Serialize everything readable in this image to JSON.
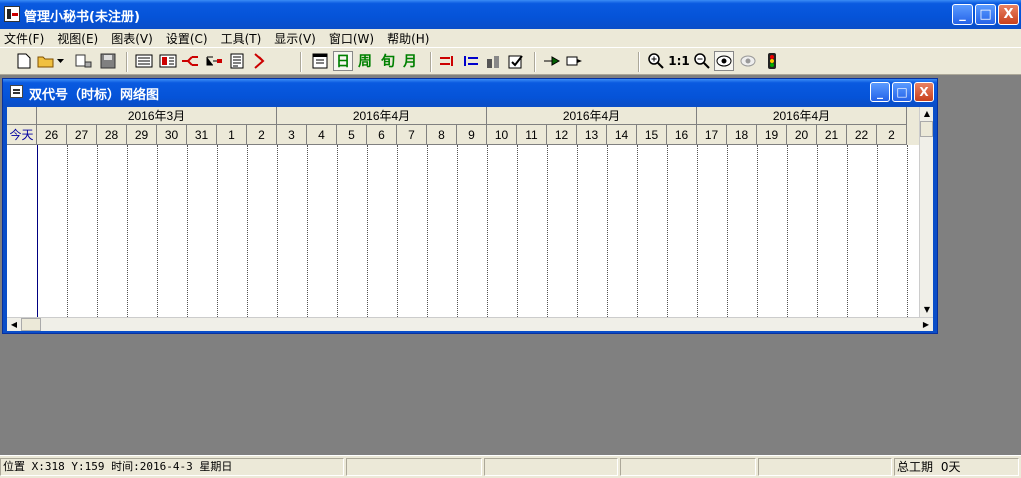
{
  "window": {
    "title": "管理小秘书(未注册)",
    "controls": {
      "minimize": "_",
      "maximize": "□",
      "close": "X"
    }
  },
  "menu": [
    "文件(F)",
    "视图(E)",
    "图表(V)",
    "设置(C)",
    "工具(T)",
    "显示(V)",
    "窗口(W)",
    "帮助(H)"
  ],
  "toolbar": {
    "scale_labels": [
      "日",
      "周",
      "旬",
      "月"
    ],
    "zoom_ratio": "1:1",
    "icons": [
      "new-file-icon",
      "open-folder-icon",
      "dropdown-icon",
      "preview-icon",
      "save-icon",
      "view1-icon",
      "view2-icon",
      "network-icon",
      "tree-icon",
      "report-icon",
      "logic-icon",
      "calendar-icon",
      "link1-icon",
      "link2-icon",
      "resource-icon",
      "check-icon",
      "arrow-icon",
      "zoom-in-icon",
      "zoom-out-icon",
      "eye-icon",
      "eye-gray-icon",
      "traffic-light-icon"
    ]
  },
  "child_window": {
    "title": "双代号（时标）网络图",
    "controls": {
      "minimize": "_",
      "maximize": "□",
      "close": "X"
    }
  },
  "gantt": {
    "months": [
      {
        "label": "2016年3月",
        "days": 8
      },
      {
        "label": "2016年4月",
        "days": 7
      },
      {
        "label": "2016年4月",
        "days": 7
      },
      {
        "label": "2016年4月",
        "days": 7
      }
    ],
    "today_label": "今天",
    "days": [
      "26",
      "27",
      "28",
      "29",
      "30",
      "31",
      "1",
      "2",
      "3",
      "4",
      "5",
      "6",
      "7",
      "8",
      "9",
      "10",
      "11",
      "12",
      "13",
      "14",
      "15",
      "16",
      "17",
      "18",
      "19",
      "20",
      "21",
      "22",
      "2"
    ]
  },
  "status": {
    "position": "位置 X:318 Y:159  时间:2016-4-3 星期日",
    "total_label": "总工期",
    "total_value": "0天"
  }
}
